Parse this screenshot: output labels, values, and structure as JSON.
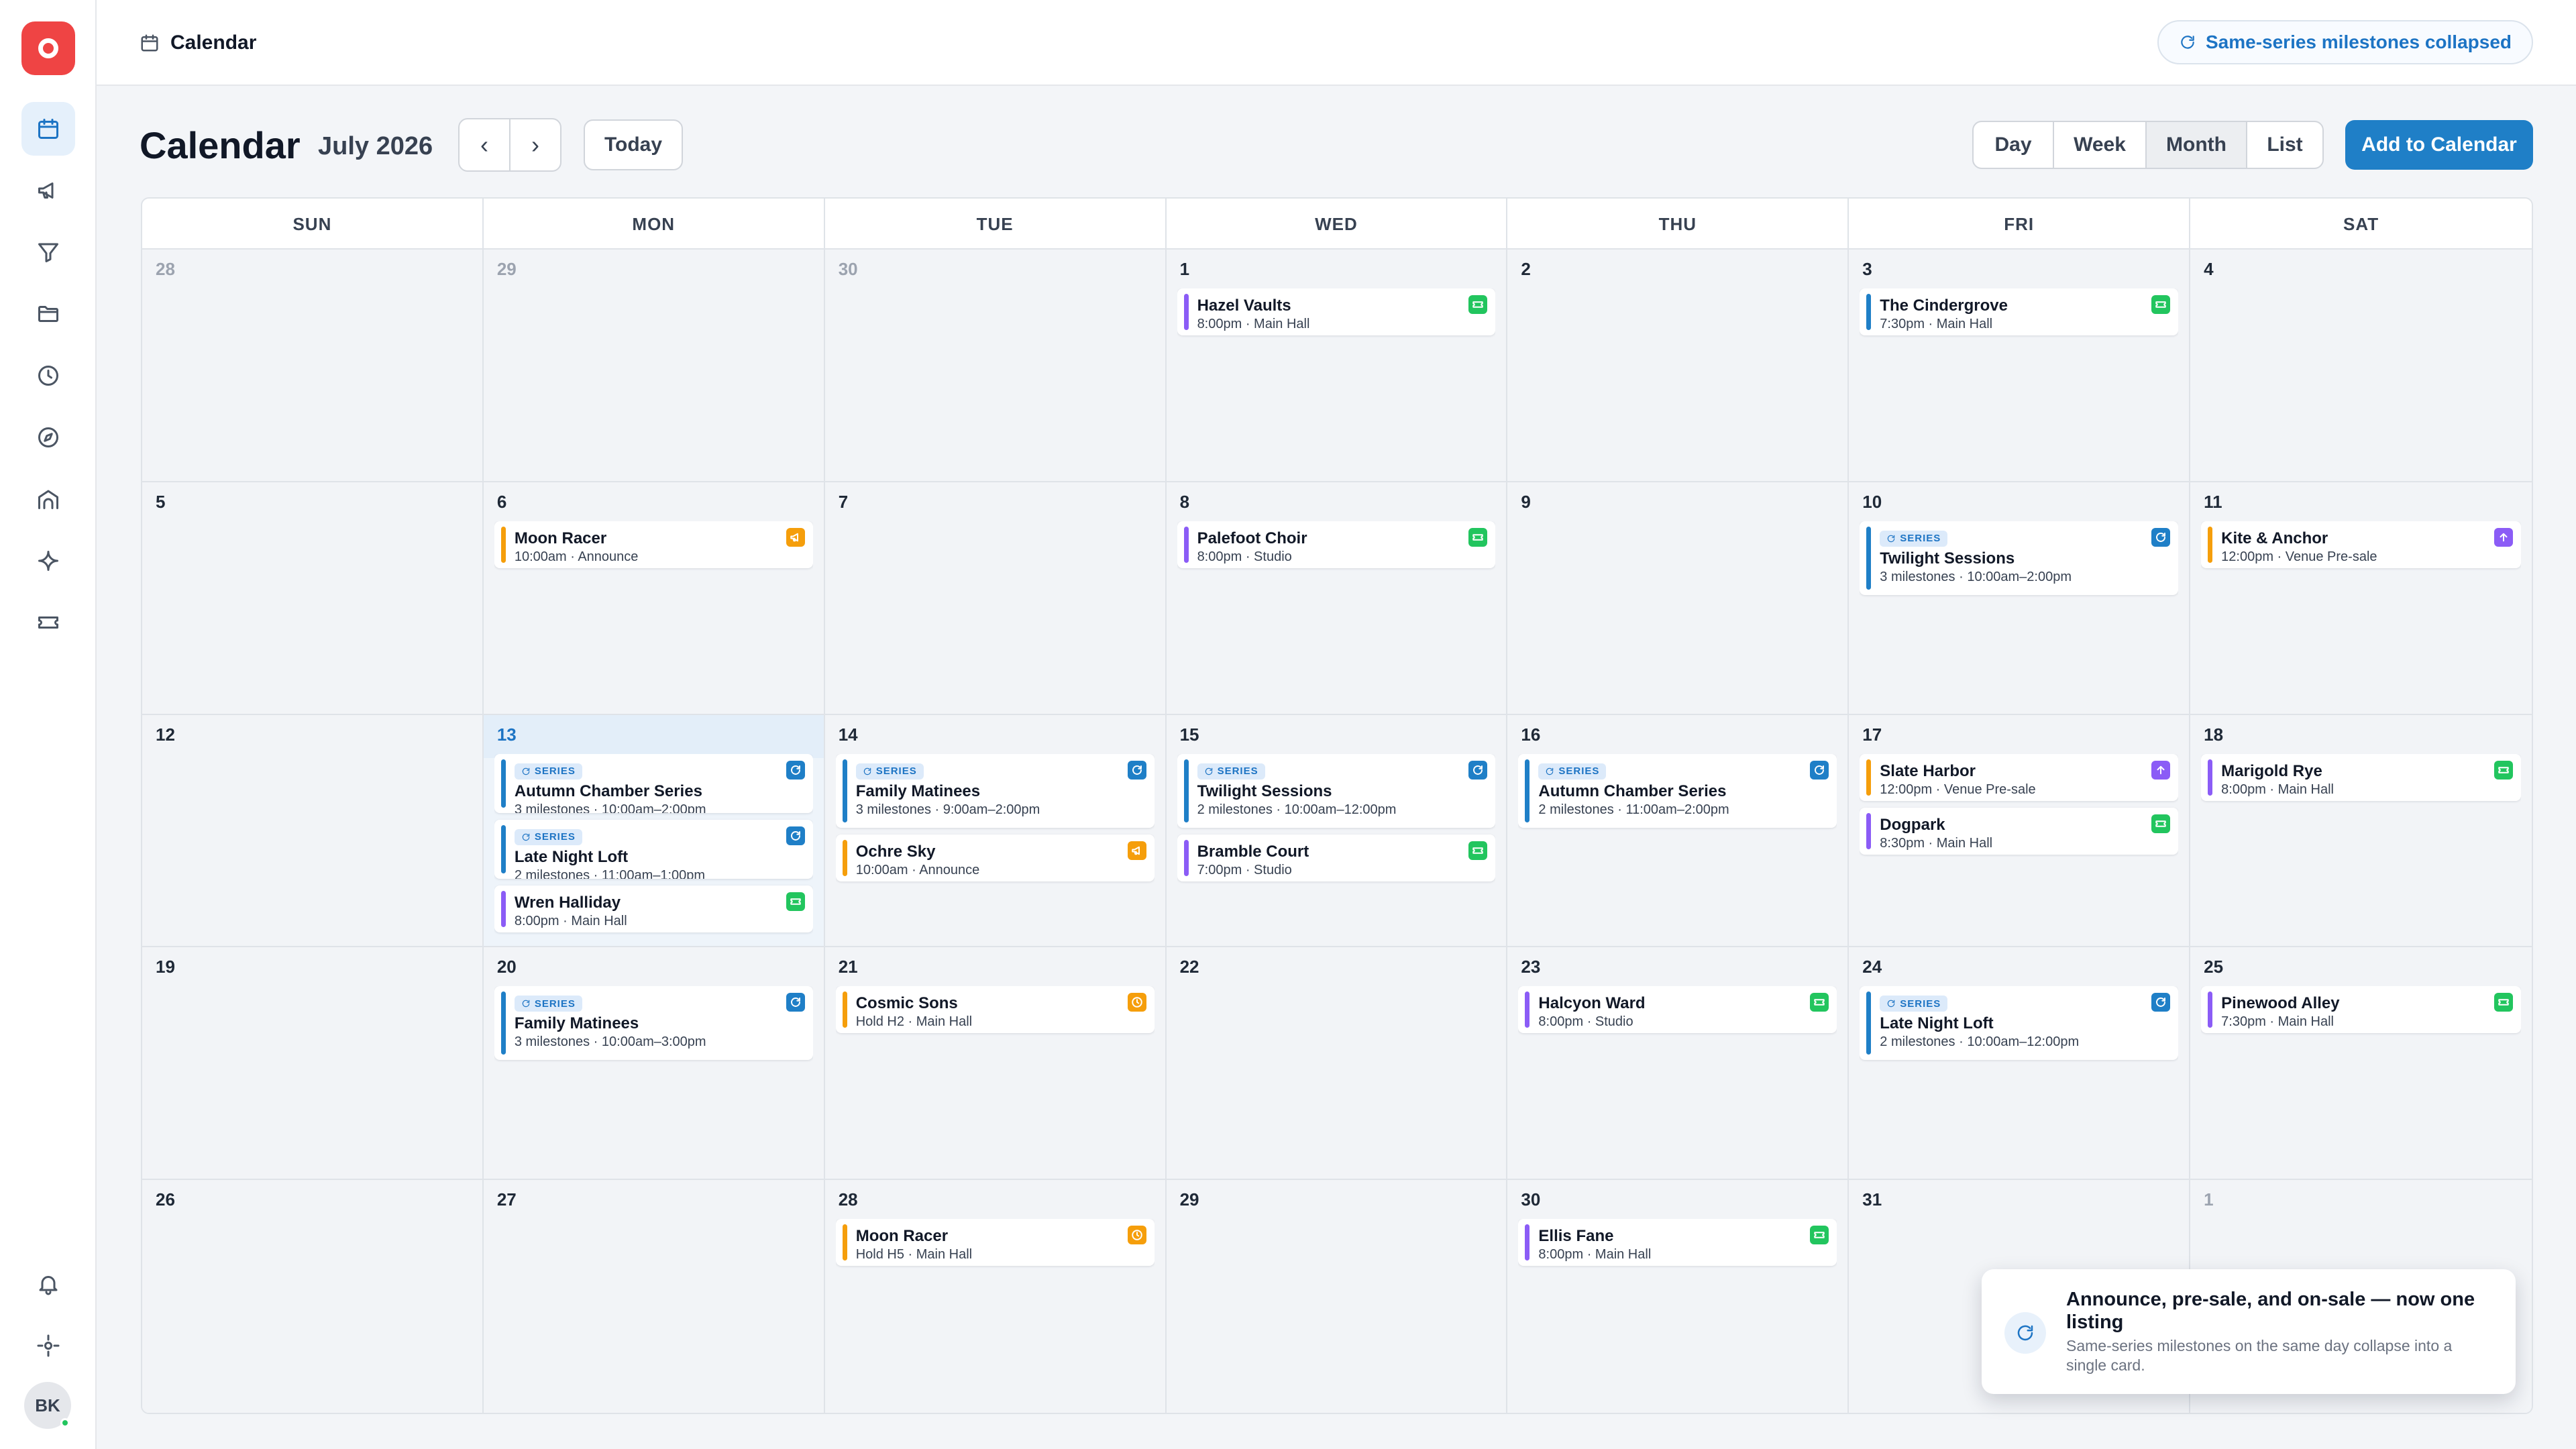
{
  "sidebar": {
    "items": [
      {
        "icon": "calendar-icon",
        "active": true
      },
      {
        "icon": "megaphone-icon"
      },
      {
        "icon": "filter-icon"
      },
      {
        "icon": "folder-icon"
      },
      {
        "icon": "clock-icon"
      },
      {
        "icon": "compass-icon"
      },
      {
        "icon": "venue-icon"
      },
      {
        "icon": "sparkle-icon"
      },
      {
        "icon": "ticket-icon"
      }
    ],
    "bottom": [
      {
        "icon": "bell-icon"
      },
      {
        "icon": "settings-icon"
      }
    ],
    "avatar_initials": "BK"
  },
  "topbar": {
    "breadcrumb": "Calendar",
    "pill_label": "Same-series milestones collapsed"
  },
  "header": {
    "title": "Calendar",
    "month_label": "July 2026",
    "prev_label": "‹",
    "next_label": "›",
    "today_label": "Today",
    "views": [
      "Day",
      "Week",
      "Month",
      "List"
    ],
    "active_view": "Month",
    "add_label": "Add to Calendar"
  },
  "colors": {
    "accent": "#1f7fc7",
    "announce": "#f59e0b",
    "presale": "#8b5cf6",
    "onsale": "#22c55e",
    "series": "#1f7fc7",
    "hold": "#f59e0b",
    "today_bg": "#eef4fa"
  },
  "calendar": {
    "weekdays": [
      "SUN",
      "MON",
      "TUE",
      "WED",
      "THU",
      "FRI",
      "SAT"
    ],
    "series_tag": "SERIES",
    "weeks": [
      [
        {
          "day": "28",
          "other": true,
          "events": []
        },
        {
          "day": "29",
          "other": true,
          "events": []
        },
        {
          "day": "30",
          "other": true,
          "events": []
        },
        {
          "day": "1",
          "events": [
            {
              "kind": "single",
              "title": "Hazel Vaults",
              "sub": "8:00pm · Main Hall",
              "bar": "#8b5cf6",
              "badge": "ticket",
              "badge_color": "#22c55e"
            }
          ]
        },
        {
          "day": "2",
          "events": []
        },
        {
          "day": "3",
          "events": [
            {
              "kind": "single",
              "title": "The Cindergrove",
              "sub": "7:30pm · Main Hall",
              "bar": "#1f7fc7",
              "badge": "ticket",
              "badge_color": "#22c55e"
            }
          ]
        },
        {
          "day": "4",
          "events": []
        }
      ],
      [
        {
          "day": "5",
          "events": []
        },
        {
          "day": "6",
          "events": [
            {
              "kind": "single",
              "title": "Moon Racer",
              "sub": "10:00am · Announce",
              "bar": "#f59e0b",
              "badge": "megaphone",
              "badge_color": "#f59e0b"
            }
          ]
        },
        {
          "day": "7",
          "events": []
        },
        {
          "day": "8",
          "events": [
            {
              "kind": "single",
              "title": "Palefoot Choir",
              "sub": "8:00pm · Studio",
              "bar": "#8b5cf6",
              "badge": "ticket",
              "badge_color": "#22c55e"
            }
          ]
        },
        {
          "day": "9",
          "events": []
        },
        {
          "day": "10",
          "events": [
            {
              "kind": "series",
              "title": "Twilight Sessions",
              "sub": "3 milestones · 10:00am–2:00pm",
              "bar": "#1f7fc7",
              "badge": "refresh",
              "badge_color": "#1f7fc7"
            }
          ]
        },
        {
          "day": "11",
          "events": [
            {
              "kind": "single",
              "title": "Kite & Anchor",
              "sub": "12:00pm · Venue Pre-sale",
              "bar": "#f59e0b",
              "badge": "arrow-up",
              "badge_color": "#8b5cf6"
            }
          ]
        }
      ],
      [
        {
          "day": "12",
          "events": []
        },
        {
          "day": "13",
          "today": true,
          "events": [
            {
              "kind": "series",
              "clip": true,
              "title": "Autumn Chamber Series",
              "sub": "3 milestones · 10:00am–2:00pm",
              "bar": "#1f7fc7",
              "badge": "refresh",
              "badge_color": "#1f7fc7"
            },
            {
              "kind": "series",
              "clip": true,
              "title": "Late Night Loft",
              "sub": "2 milestones · 11:00am–1:00pm",
              "bar": "#1f7fc7",
              "badge": "refresh",
              "badge_color": "#1f7fc7"
            },
            {
              "kind": "single",
              "title": "Wren Halliday",
              "sub": "8:00pm · Main Hall",
              "bar": "#8b5cf6",
              "badge": "ticket",
              "badge_color": "#22c55e"
            }
          ]
        },
        {
          "day": "14",
          "events": [
            {
              "kind": "series",
              "title": "Family Matinees",
              "sub": "3 milestones · 9:00am–2:00pm",
              "bar": "#1f7fc7",
              "badge": "refresh",
              "badge_color": "#1f7fc7"
            },
            {
              "kind": "single",
              "title": "Ochre Sky",
              "sub": "10:00am · Announce",
              "bar": "#f59e0b",
              "badge": "megaphone",
              "badge_color": "#f59e0b"
            }
          ]
        },
        {
          "day": "15",
          "events": [
            {
              "kind": "series",
              "title": "Twilight Sessions",
              "sub": "2 milestones · 10:00am–12:00pm",
              "bar": "#1f7fc7",
              "badge": "refresh",
              "badge_color": "#1f7fc7"
            },
            {
              "kind": "single",
              "title": "Bramble Court",
              "sub": "7:00pm · Studio",
              "bar": "#8b5cf6",
              "badge": "ticket",
              "badge_color": "#22c55e"
            }
          ]
        },
        {
          "day": "16",
          "events": [
            {
              "kind": "series",
              "title": "Autumn Chamber Series",
              "sub": "2 milestones · 11:00am–2:00pm",
              "bar": "#1f7fc7",
              "badge": "refresh",
              "badge_color": "#1f7fc7"
            }
          ]
        },
        {
          "day": "17",
          "events": [
            {
              "kind": "single",
              "title": "Slate Harbor",
              "sub": "12:00pm · Venue Pre-sale",
              "bar": "#f59e0b",
              "badge": "arrow-up",
              "badge_color": "#8b5cf6"
            },
            {
              "kind": "single",
              "title": "Dogpark",
              "sub": "8:30pm · Main Hall",
              "bar": "#8b5cf6",
              "badge": "ticket",
              "badge_color": "#22c55e"
            }
          ]
        },
        {
          "day": "18",
          "events": [
            {
              "kind": "single",
              "title": "Marigold Rye",
              "sub": "8:00pm · Main Hall",
              "bar": "#8b5cf6",
              "badge": "ticket",
              "badge_color": "#22c55e"
            }
          ]
        }
      ],
      [
        {
          "day": "19",
          "events": []
        },
        {
          "day": "20",
          "events": [
            {
              "kind": "series",
              "title": "Family Matinees",
              "sub": "3 milestones · 10:00am–3:00pm",
              "bar": "#1f7fc7",
              "badge": "refresh",
              "badge_color": "#1f7fc7"
            }
          ]
        },
        {
          "day": "21",
          "events": [
            {
              "kind": "single",
              "title": "Cosmic Sons",
              "sub": "Hold H2 · Main Hall",
              "bar": "#f59e0b",
              "badge": "clock",
              "badge_color": "#f59e0b"
            }
          ]
        },
        {
          "day": "22",
          "events": []
        },
        {
          "day": "23",
          "events": [
            {
              "kind": "single",
              "title": "Halcyon Ward",
              "sub": "8:00pm · Studio",
              "bar": "#8b5cf6",
              "badge": "ticket",
              "badge_color": "#22c55e"
            }
          ]
        },
        {
          "day": "24",
          "events": [
            {
              "kind": "series",
              "title": "Late Night Loft",
              "sub": "2 milestones · 10:00am–12:00pm",
              "bar": "#1f7fc7",
              "badge": "refresh",
              "badge_color": "#1f7fc7"
            }
          ]
        },
        {
          "day": "25",
          "events": [
            {
              "kind": "single",
              "title": "Pinewood Alley",
              "sub": "7:30pm · Main Hall",
              "bar": "#8b5cf6",
              "badge": "ticket",
              "badge_color": "#22c55e"
            }
          ]
        }
      ],
      [
        {
          "day": "26",
          "events": []
        },
        {
          "day": "27",
          "events": []
        },
        {
          "day": "28",
          "events": [
            {
              "kind": "single",
              "title": "Moon Racer",
              "sub": "Hold H5 · Main Hall",
              "bar": "#f59e0b",
              "badge": "clock",
              "badge_color": "#f59e0b"
            }
          ]
        },
        {
          "day": "29",
          "events": []
        },
        {
          "day": "30",
          "events": [
            {
              "kind": "single",
              "title": "Ellis Fane",
              "sub": "8:00pm · Main Hall",
              "bar": "#8b5cf6",
              "badge": "ticket",
              "badge_color": "#22c55e"
            }
          ]
        },
        {
          "day": "31",
          "events": []
        },
        {
          "day": "1",
          "other": true,
          "events": []
        }
      ]
    ]
  },
  "toast": {
    "title": "Announce, pre-sale, and on-sale — now one listing",
    "body": "Same-series milestones on the same day collapse into a single card."
  }
}
